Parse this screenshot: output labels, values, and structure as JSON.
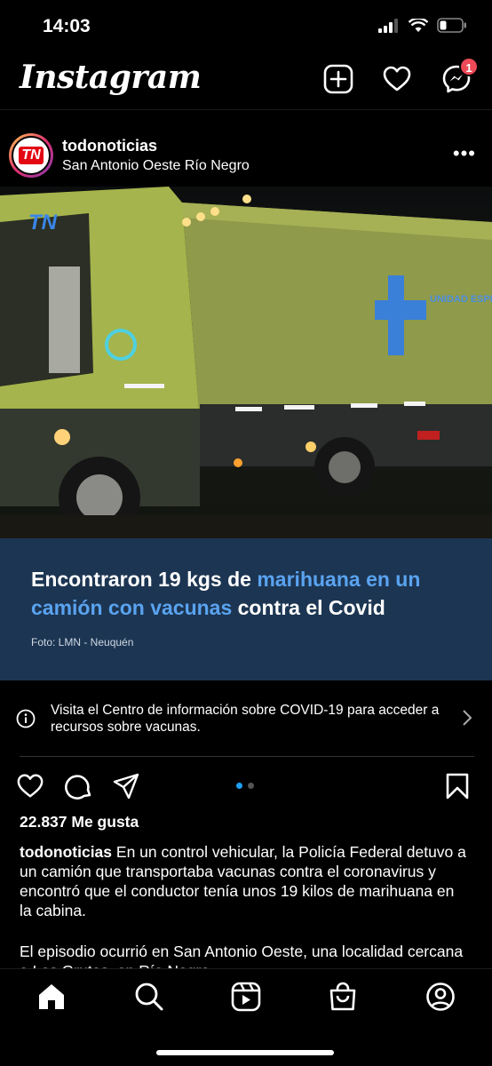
{
  "status_bar": {
    "time": "14:03"
  },
  "header": {
    "logo": "Instagram",
    "messages_badge": "1"
  },
  "post": {
    "username": "todonoticias",
    "location": "San Antonio Oeste Río Negro",
    "image": {
      "watermark": "TN",
      "truck_text": "UNIDAD ESPECIAL DE SALUD",
      "headline_part1": "Encontraron 19 kgs de ",
      "headline_highlight1": "marihuana en un camión con vacunas",
      "headline_part2": " contra el Covid",
      "photo_credit": "Foto: LMN - Neuquén"
    },
    "covid_info": "Visita el Centro de información sobre COVID-19 para acceder a recursos sobre vacunas.",
    "carousel": {
      "count": 2,
      "active": 1
    },
    "likes": "22.837 Me gusta",
    "caption_user": "todonoticias",
    "caption_text": " En un control vehicular, la Policía Federal detuvo a un camión que transportaba vacunas contra el coronavirus y encontró que el conductor tenía unos 19 kilos de marihuana en la cabina.",
    "caption_text2": "El episodio ocurrió en San Antonio Oeste, una localidad cercana a Las Grutas, en Río Negro."
  },
  "colors": {
    "background": "#000000",
    "card": "#1c3552",
    "highlight": "#5aa3f0",
    "badge": "#ed4956",
    "active_dot": "#1da1f2"
  },
  "icons": {
    "header": [
      "new-post-icon",
      "heart-icon",
      "messenger-icon"
    ],
    "actions": [
      "like-icon",
      "comment-icon",
      "share-icon",
      "bookmark-icon"
    ],
    "nav": [
      "home-icon",
      "search-icon",
      "reels-icon",
      "shop-icon",
      "profile-icon"
    ]
  }
}
